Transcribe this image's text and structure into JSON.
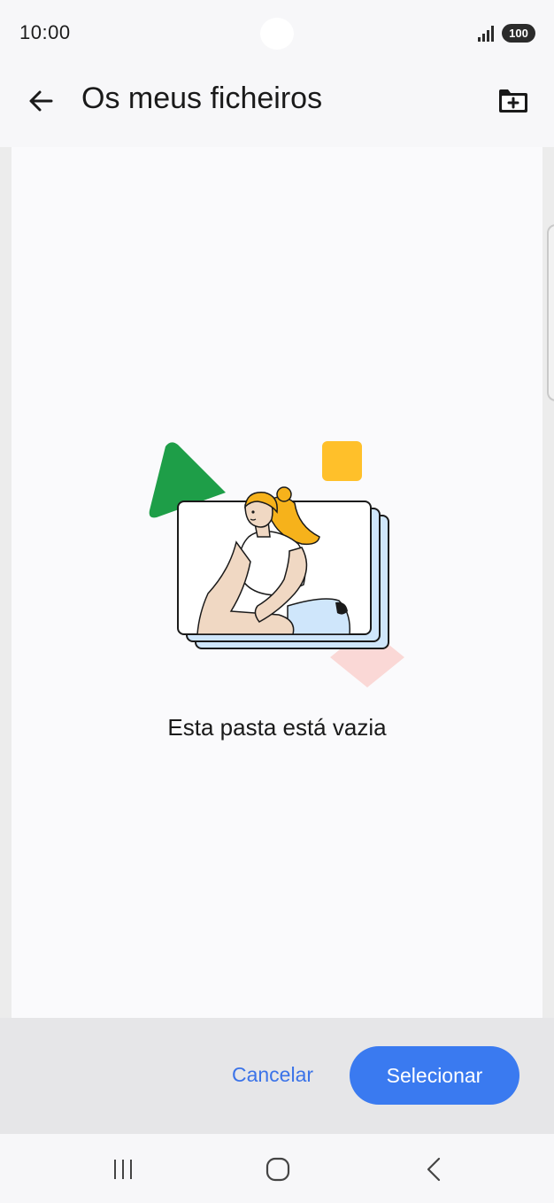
{
  "status_bar": {
    "time": "10:00",
    "battery": "100",
    "signal_icon": "signal-bars-icon"
  },
  "app_bar": {
    "title": "Os meus ficheiros",
    "back_icon": "arrow-left-icon",
    "new_folder_icon": "create-folder-icon"
  },
  "content": {
    "empty_message": "Esta pasta está vazia",
    "illustration": "empty-folder-illustration"
  },
  "actions": {
    "cancel_label": "Cancelar",
    "select_label": "Selecionar"
  },
  "nav_bar": {
    "recents_icon": "recent-apps-icon",
    "home_icon": "home-icon",
    "back_icon": "back-icon"
  },
  "colors": {
    "accent": "#3a7af0",
    "cancel_text": "#3b73e8",
    "green_shape": "#1e9e48",
    "yellow_shape": "#ffc02a",
    "pink_shape": "#fad8d6",
    "hair": "#f6b21b",
    "skin": "#f0d8c3",
    "card_back": "#cfe6fb"
  }
}
